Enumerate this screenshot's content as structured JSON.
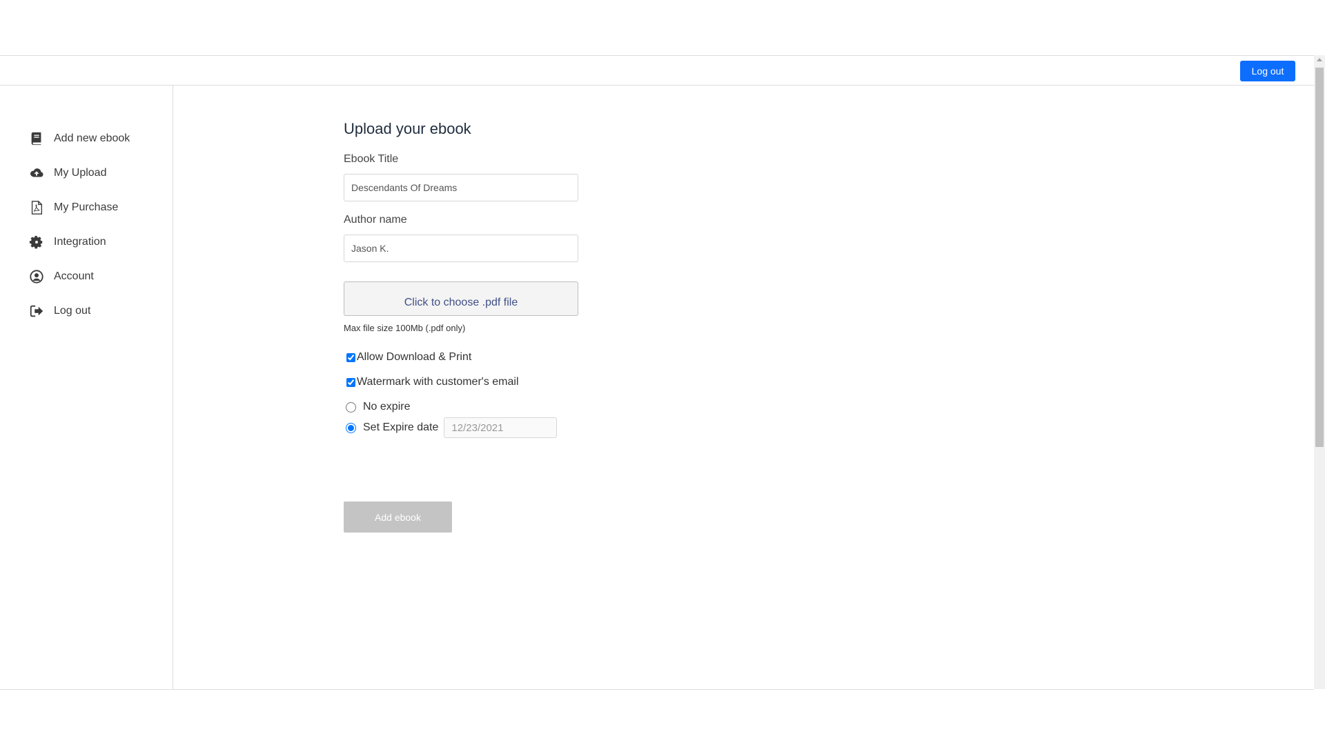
{
  "header": {
    "logout_label": "Log out",
    "accent_color": "#0d6efd"
  },
  "sidebar": {
    "items": [
      {
        "label": "Add new ebook",
        "icon": "book-icon"
      },
      {
        "label": "My Upload",
        "icon": "cloud-upload-icon"
      },
      {
        "label": "My Purchase",
        "icon": "pdf-file-icon"
      },
      {
        "label": "Integration",
        "icon": "gear-icon"
      },
      {
        "label": "Account",
        "icon": "user-circle-icon"
      },
      {
        "label": "Log out",
        "icon": "sign-out-icon"
      }
    ]
  },
  "form": {
    "title": "Upload your ebook",
    "ebook_title_label": "Ebook Title",
    "ebook_title_value": "Descendants Of Dreams",
    "author_label": "Author name",
    "author_value": "Jason K.",
    "file_button_label": "Click to choose .pdf file",
    "file_hint": "Max file size 100Mb (.pdf only)",
    "allow_download_label": "Allow Download & Print",
    "allow_download_checked": true,
    "watermark_label": "Watermark with customer's email",
    "watermark_checked": true,
    "no_expire_label": "No expire",
    "set_expire_label": "Set Expire date",
    "expire_selected": "set",
    "expire_date_value": "12/23/2021",
    "submit_label": "Add ebook",
    "submit_color": "#c4c4c4"
  }
}
